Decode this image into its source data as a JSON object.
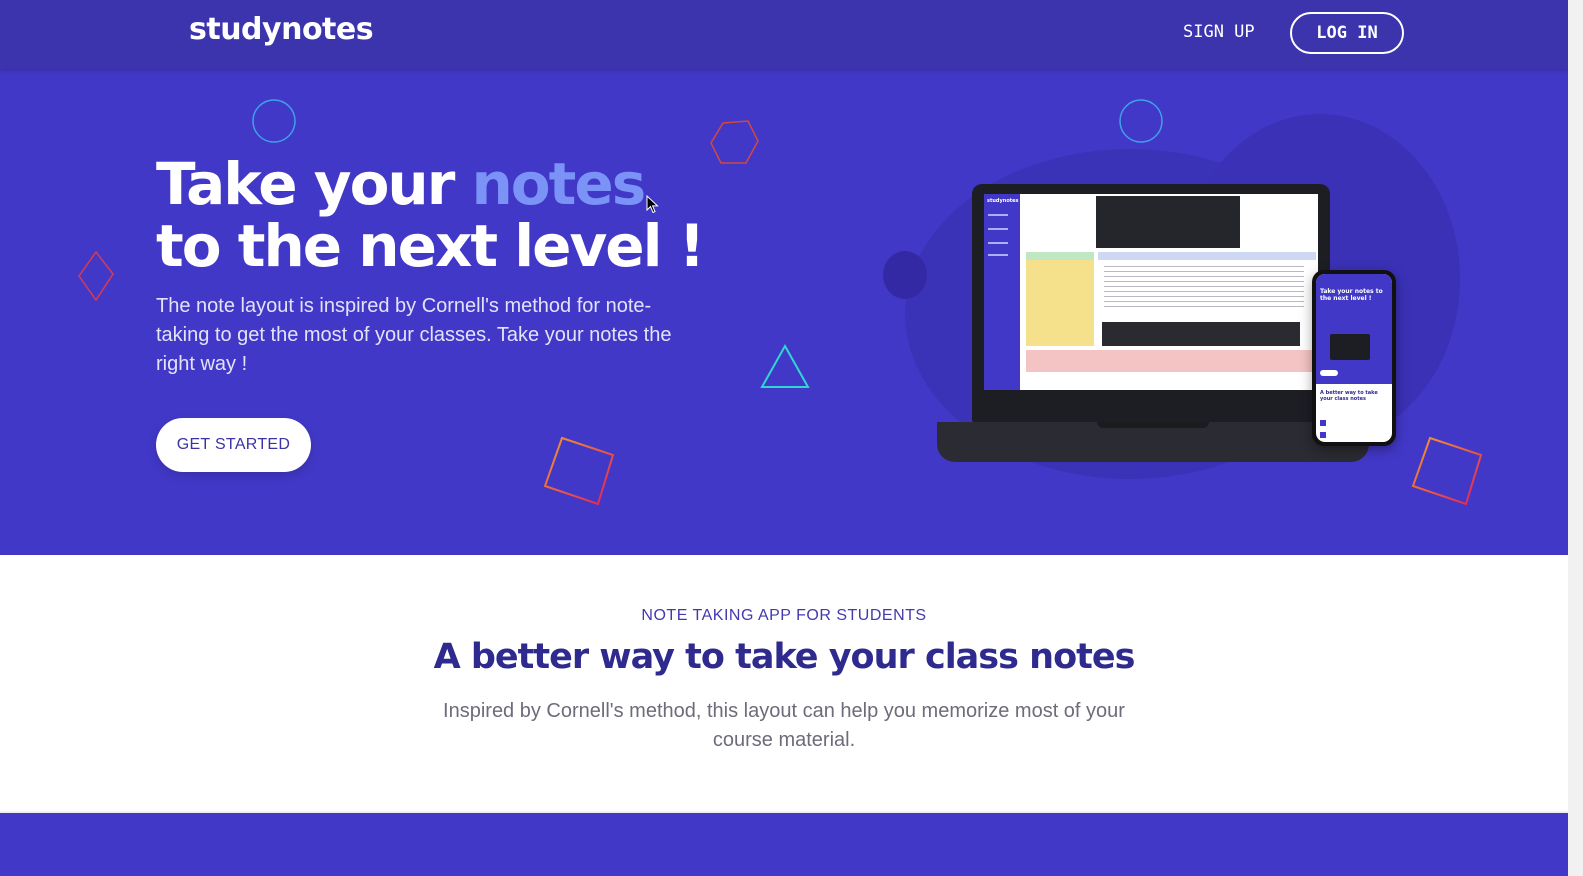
{
  "navbar": {
    "logo": "studynotes",
    "signup_label": "SIGN UP",
    "login_label": "LOG IN"
  },
  "hero": {
    "headline_part1": "Take your ",
    "headline_accent": "notes",
    "headline_part2": "to the next level !",
    "description": "The note layout is inspired by Cornell's method for note-taking to get the most of your classes. Take your notes the right way !",
    "cta_label": "GET STARTED",
    "mockup": {
      "laptop_app_name": "studynotes",
      "phone_title": "Take your notes to the next level !",
      "phone_section_title": "A better way to take your class notes"
    }
  },
  "features": {
    "eyebrow": "NOTE TAKING APP FOR STUDENTS",
    "title": "A better way to take your class notes",
    "description": "Inspired by Cornell's method, this layout can help you memorize most of your course material."
  },
  "colors": {
    "nav_bg": "#3b34ad",
    "hero_bg": "#4238c8",
    "accent": "#7b92f7",
    "title_dark": "#2f2a8e",
    "white": "#ffffff"
  },
  "icons": [
    "circle-outline-icon",
    "hexagon-outline-icon",
    "diamond-outline-icon",
    "triangle-outline-icon",
    "square-outline-icon",
    "mouse-cursor-icon"
  ]
}
